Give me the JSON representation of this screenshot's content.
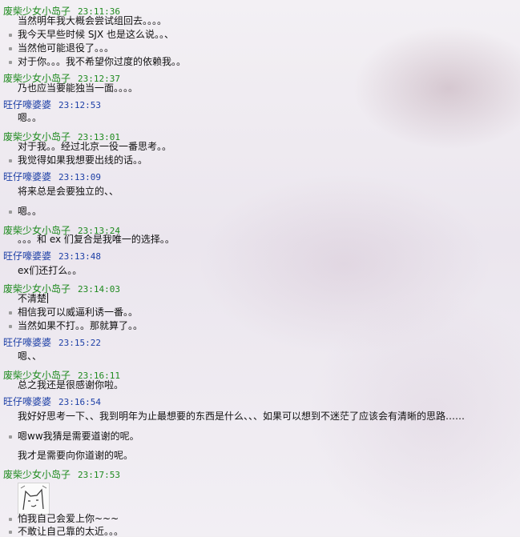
{
  "chat": {
    "messages": [
      {
        "sender": "废柴少女小岛子",
        "time": "23:11:36",
        "lines": [
          "当然明年我大概会尝试组回去。。。。",
          "我今天早些时候 SJX 也是这么说。。、",
          "当然他可能退役了。。。",
          "对于你。。。我不希望你过度的依赖我。。"
        ]
      },
      {
        "sender": "废柴少女小岛子",
        "time": "23:12:37",
        "lines": [
          "乃也应当要能独当一面。。。。"
        ]
      },
      {
        "sender": "旺仔嚎婆婆",
        "time": "23:12:53",
        "lines": [
          "嗯。。"
        ]
      },
      {
        "sender": "废柴少女小岛子",
        "time": "23:13:01",
        "lines": [
          "对于我。。经过北京一役一番思考。。",
          "我觉得如果我想要出线的话。。"
        ]
      },
      {
        "sender": "旺仔嚎婆婆",
        "time": "23:13:09",
        "lines": [
          "将来总是会要独立的、、",
          "嗯。。"
        ]
      },
      {
        "sender": "废柴少女小岛子",
        "time": "23:13:24",
        "lines": [
          "。。。和 ex 们复合是我唯一的选择。。"
        ]
      },
      {
        "sender": "旺仔嚎婆婆",
        "time": "23:13:48",
        "lines": [
          "ex们还打么。。"
        ]
      },
      {
        "sender": "废柴少女小岛子",
        "time": "23:14:03",
        "lines": [
          "不清楚",
          "相信我可以威逼利诱一番。。",
          "当然如果不打。。那就算了。。"
        ]
      },
      {
        "sender": "旺仔嚎婆婆",
        "time": "23:15:22",
        "lines": [
          "嗯、、"
        ]
      },
      {
        "sender": "废柴少女小岛子",
        "time": "23:16:11",
        "lines": [
          "总之我还是很感谢你啦。"
        ]
      },
      {
        "sender": "旺仔嚎婆婆",
        "time": "23:16:54",
        "lines": [
          "我好好思考一下、、我到明年为止最想要的东西是什么、、、如果可以想到不迷茫了应该会有清晰的思路……",
          "嗯ww我猜是需要道谢的呢。",
          "我才是需要向你道谢的呢。"
        ]
      },
      {
        "sender": "废柴少女小岛子",
        "time": "23:17:53",
        "lines": [
          "怕我自己会爱上你~~~",
          "不敢让自己靠的太近。。。"
        ]
      }
    ]
  },
  "colors": {
    "sender_self": "#1e8a1e",
    "sender_other": "#1d3fa6",
    "text": "#111111",
    "bullet": "#9a9a9a"
  },
  "icons": {
    "sticker": "doodle-face-sticker-icon"
  }
}
